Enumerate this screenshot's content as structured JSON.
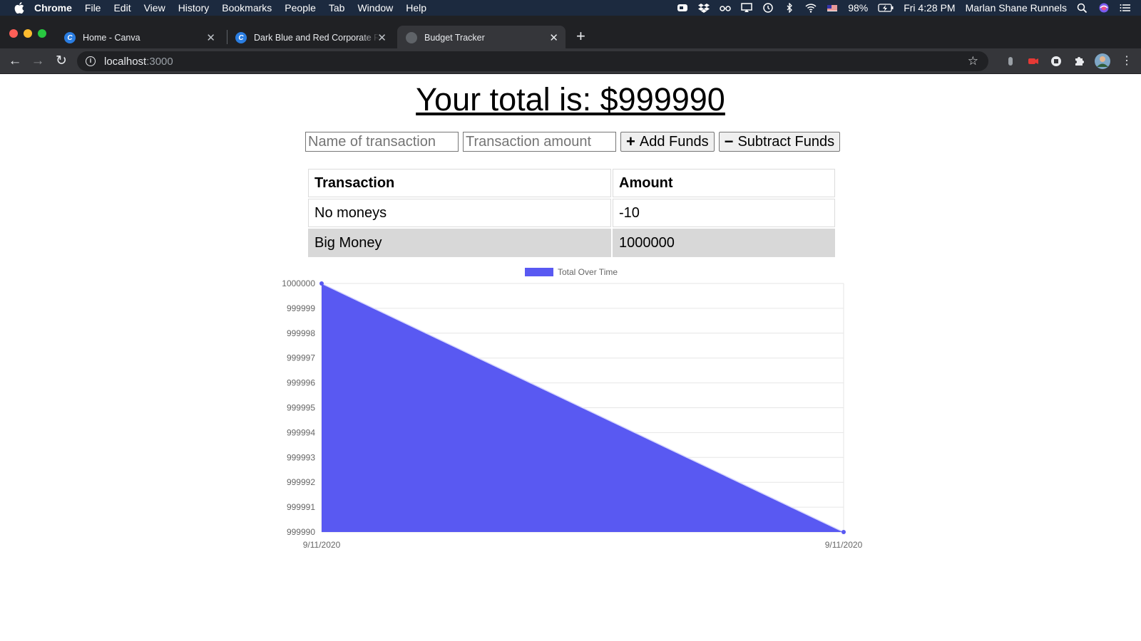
{
  "menubar": {
    "app": "Chrome",
    "items": [
      "File",
      "Edit",
      "View",
      "History",
      "Bookmarks",
      "People",
      "Tab",
      "Window",
      "Help"
    ],
    "battery": "98%",
    "clock": "Fri 4:28 PM",
    "user": "Marlan Shane Runnels"
  },
  "tabs": [
    {
      "title": "Home - Canva",
      "icon": "canva-icon"
    },
    {
      "title": "Dark Blue and Red Corporate R",
      "icon": "canva-icon"
    },
    {
      "title": "Budget Tracker",
      "icon": "globe-icon"
    }
  ],
  "address": {
    "host": "localhost",
    "port": ":3000"
  },
  "page": {
    "total_label": "Your total is: $999990",
    "name_placeholder": "Name of transaction",
    "amount_placeholder": "Transaction amount",
    "add_label": "Add Funds",
    "subtract_label": "Subtract Funds",
    "table": {
      "headers": [
        "Transaction",
        "Amount"
      ],
      "rows": [
        {
          "name": "No moneys",
          "amount": "-10"
        },
        {
          "name": "Big Money",
          "amount": "1000000"
        }
      ]
    }
  },
  "colors": {
    "fill": "#5959f2",
    "accent": "#1a73e8"
  },
  "chart_data": {
    "type": "area",
    "x": [
      "9/11/2020",
      "9/11/2020"
    ],
    "series": [
      {
        "name": "Total Over Time",
        "values": [
          1000000,
          999990
        ],
        "color": "#5959f2"
      }
    ],
    "ylim": [
      999990,
      1000000
    ],
    "yticks": [
      "1000000",
      "999999",
      "999998",
      "999997",
      "999996",
      "999995",
      "999994",
      "999993",
      "999992",
      "999991",
      "999990"
    ],
    "legend": "top-center",
    "grid": true
  }
}
